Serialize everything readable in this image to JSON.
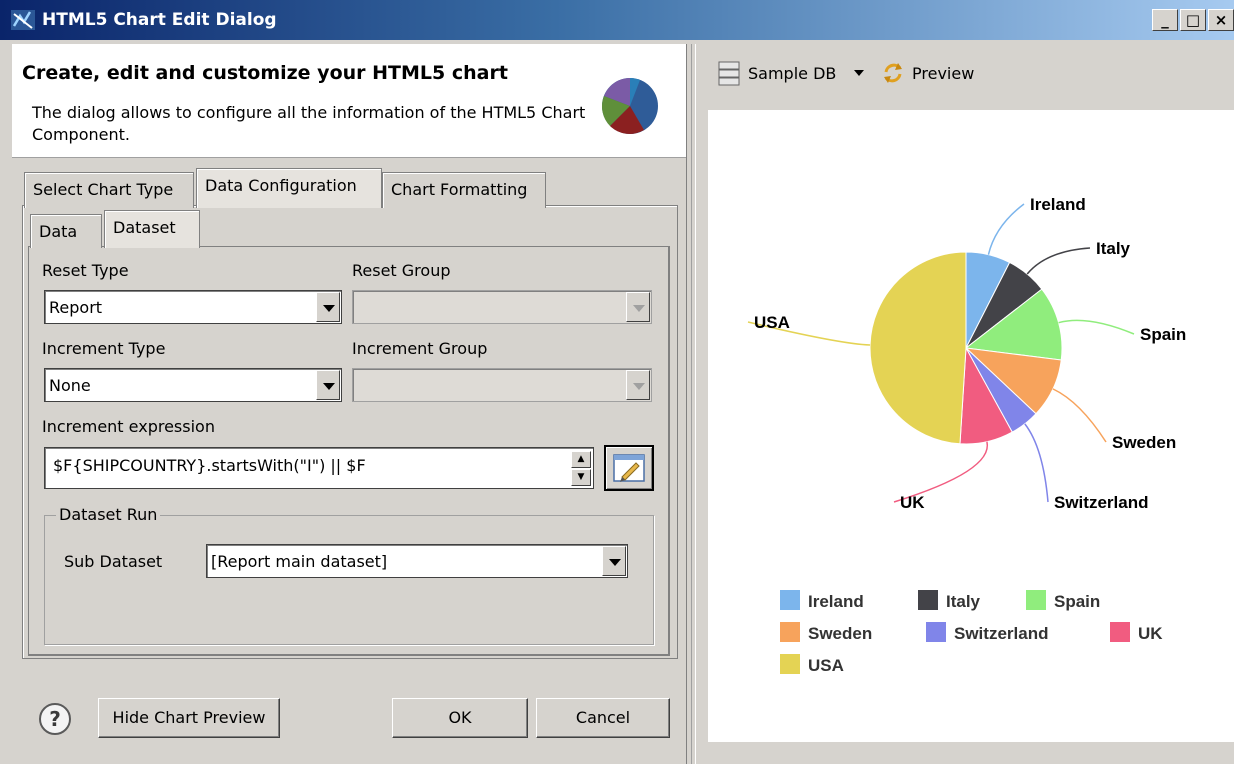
{
  "window": {
    "title": "HTML5 Chart Edit Dialog",
    "controls": [
      "_",
      "□",
      "×"
    ]
  },
  "header": {
    "title": "Create, edit and customize your HTML5 chart",
    "description": "The dialog allows to configure all the information of the HTML5 Chart Component."
  },
  "tabs": [
    {
      "label": "Select Chart Type",
      "active": false
    },
    {
      "label": "Data Configuration",
      "active": true
    },
    {
      "label": "Chart Formatting",
      "active": false
    }
  ],
  "subtabs": [
    {
      "label": "Data",
      "active": false
    },
    {
      "label": "Dataset",
      "active": true
    }
  ],
  "form": {
    "reset_type": {
      "label": "Reset Type",
      "value": "Report"
    },
    "reset_group": {
      "label": "Reset Group",
      "value": "",
      "disabled": true
    },
    "increment_type": {
      "label": "Increment Type",
      "value": "None"
    },
    "increment_group": {
      "label": "Increment Group",
      "value": "",
      "disabled": true
    },
    "increment_expression": {
      "label": "Increment expression",
      "value": "$F{SHIPCOUNTRY}.startsWith(\"I\") || $F"
    },
    "dataset_run": {
      "title": "Dataset Run",
      "sub_dataset_label": "Sub Dataset",
      "sub_dataset_value": "[Report main dataset]"
    }
  },
  "buttons": {
    "help": "?",
    "hide_preview": "Hide Chart Preview",
    "ok": "OK",
    "cancel": "Cancel"
  },
  "preview_toolbar": {
    "datasource": "Sample DB",
    "preview": "Preview"
  },
  "chart_data": {
    "type": "pie",
    "categories": [
      "Ireland",
      "Italy",
      "Spain",
      "Sweden",
      "Switzerland",
      "UK",
      "USA"
    ],
    "values": [
      7.5,
      7,
      12.5,
      10,
      5,
      9,
      49
    ],
    "colors": [
      "#7cb5ec",
      "#434348",
      "#90ed7d",
      "#f7a35c",
      "#8085e9",
      "#f15c80",
      "#e4d354"
    ],
    "legend_position": "bottom"
  }
}
